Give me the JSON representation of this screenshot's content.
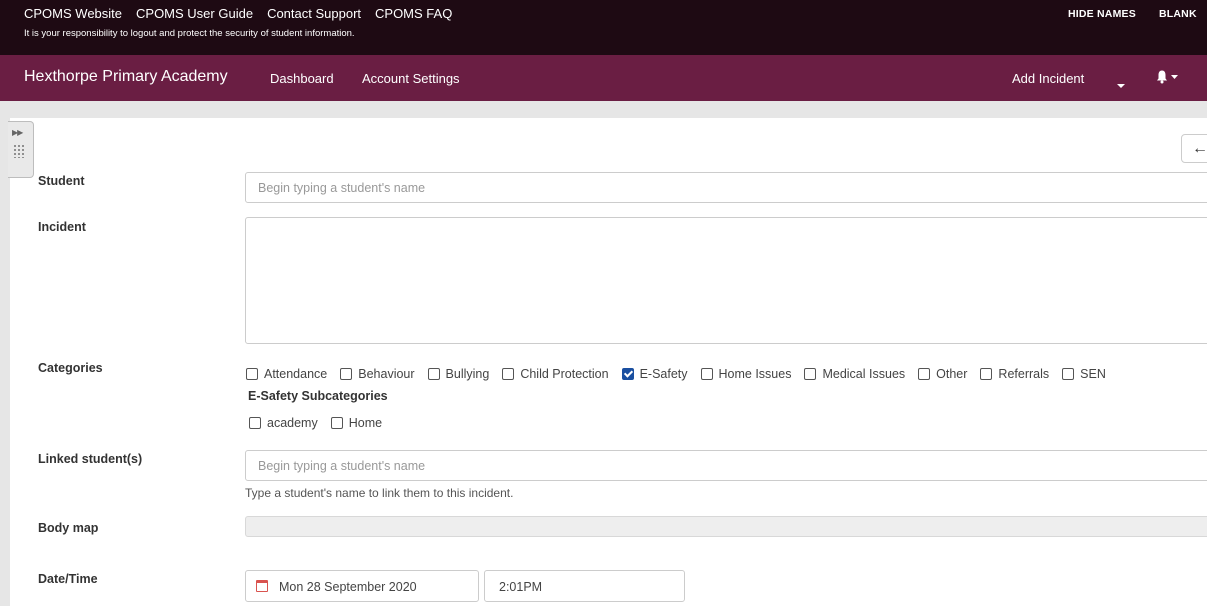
{
  "topbar": {
    "links": [
      "CPOMS Website",
      "CPOMS User Guide",
      "Contact Support",
      "CPOMS FAQ"
    ],
    "notice": "It is your responsibility to logout and protect the security of student information.",
    "hide_names": "HIDE NAMES",
    "blank": "BLANK"
  },
  "navbar": {
    "brand": "Hexthorpe Primary Academy",
    "dashboard": "Dashboard",
    "account_settings": "Account Settings",
    "add_incident": "Add Incident"
  },
  "form": {
    "student_label": "Student",
    "student_placeholder": "Begin typing a student's name",
    "incident_label": "Incident",
    "categories_label": "Categories",
    "categories": [
      {
        "label": "Attendance",
        "checked": false
      },
      {
        "label": "Behaviour",
        "checked": false
      },
      {
        "label": "Bullying",
        "checked": false
      },
      {
        "label": "Child Protection",
        "checked": false
      },
      {
        "label": "E-Safety",
        "checked": true
      },
      {
        "label": "Home Issues",
        "checked": false
      },
      {
        "label": "Medical Issues",
        "checked": false
      },
      {
        "label": "Other",
        "checked": false
      },
      {
        "label": "Referrals",
        "checked": false
      },
      {
        "label": "SEN",
        "checked": false
      }
    ],
    "subcategories_heading": "E-Safety Subcategories",
    "subcategories": [
      {
        "label": "academy",
        "checked": false
      },
      {
        "label": "Home",
        "checked": false
      }
    ],
    "linked_label": "Linked student(s)",
    "linked_placeholder": "Begin typing a student's name",
    "linked_help": "Type a student's name to link them to this incident.",
    "bodymap_label": "Body map",
    "datetime_label": "Date/Time",
    "date_value": "Mon 28 September 2020",
    "time_value": "2:01PM"
  },
  "icons": {
    "back": "arrow-left-icon",
    "bell": "bell-icon",
    "calendar": "calendar-icon"
  },
  "colors": {
    "topbar_bg": "#1e0a13",
    "navbar_bg": "#6a1e43",
    "checkbox_checked": "#1a4fa0"
  }
}
